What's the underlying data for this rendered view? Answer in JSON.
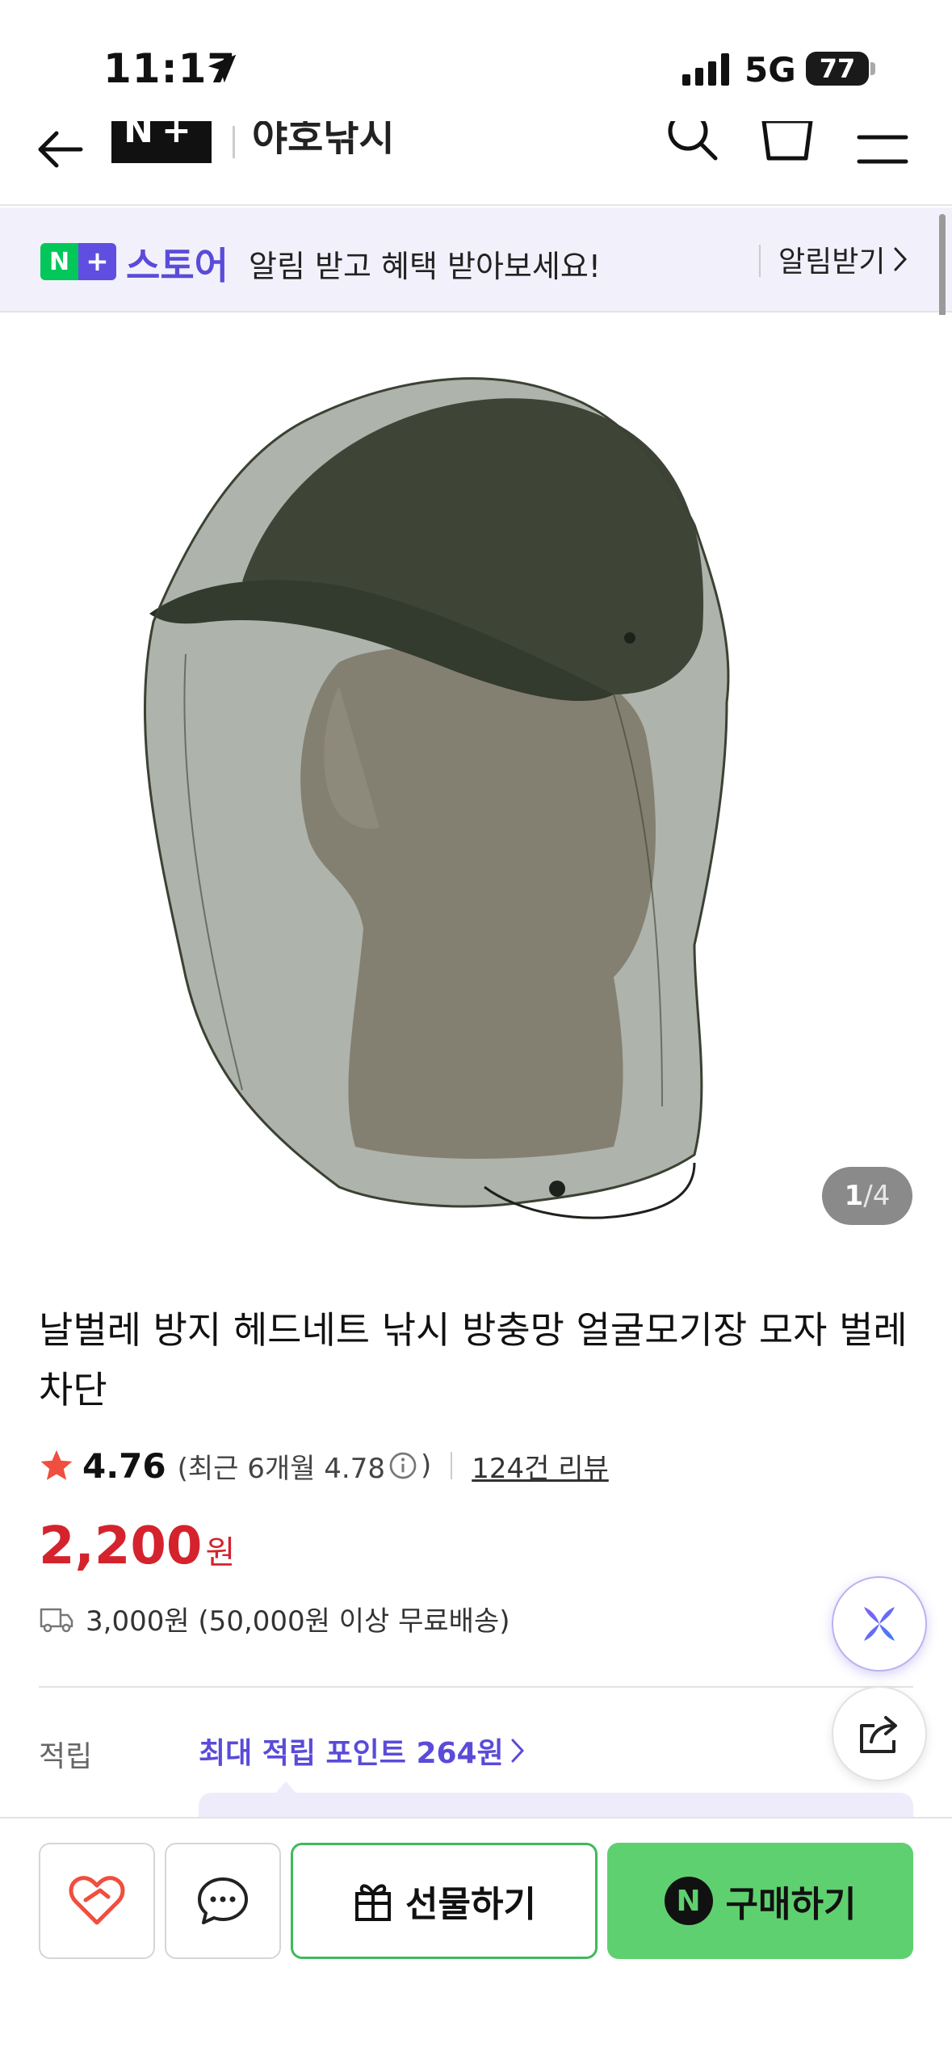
{
  "status_bar": {
    "time": "11:17",
    "network": "5G",
    "battery": "77"
  },
  "header": {
    "brand_logo": "N+",
    "store_name": "야호낚시"
  },
  "banner": {
    "badge_n": "N",
    "badge_plus": "+",
    "store_label": "스토어",
    "message": "알림 받고 혜택 받아보세요!",
    "action_label": "알림받기"
  },
  "gallery": {
    "current": "1",
    "separator": "/",
    "total": "4"
  },
  "product": {
    "title": "날벌레 방지 헤드네트 낚시 방충망 얼굴모기장 모자 벌레 차단",
    "rating": "4.76",
    "rating_recent_prefix": "(최근 6개월 4.78",
    "rating_recent_suffix": ")",
    "review_link": "124건 리뷰",
    "price": "2,200",
    "price_unit": "원",
    "shipping": "3,000원 (50,000원 이상 무료배송)",
    "points_label": "적립",
    "points_value": "최대 적립 포인트 264원"
  },
  "actions": {
    "gift_label": "선물하기",
    "buy_label": "구매하기",
    "buy_badge": "N"
  },
  "colors": {
    "accent_purple": "#5a4bd9",
    "price_red": "#d4232d",
    "naver_green": "#5fd06f",
    "rating_star": "#f04e3e"
  }
}
